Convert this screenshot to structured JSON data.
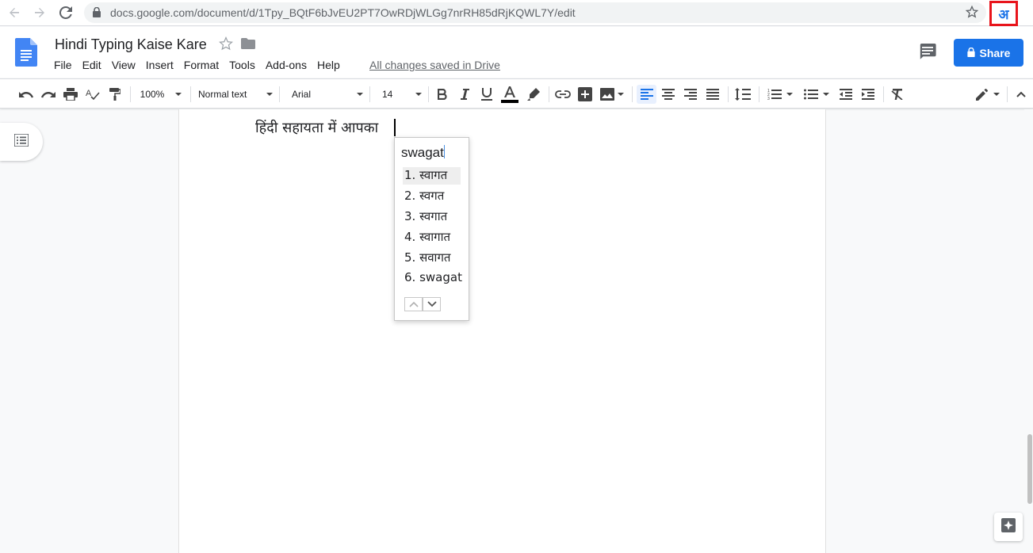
{
  "browser": {
    "url": "docs.google.com/document/d/1Tpy_BQtF6bJvEU2PT7OwRDjWLGg7nrRH85dRjKQWL7Y/edit",
    "extension_label": "अ"
  },
  "header": {
    "doc_title": "Hindi Typing Kaise Kare",
    "menu": [
      "File",
      "Edit",
      "View",
      "Insert",
      "Format",
      "Tools",
      "Add-ons",
      "Help"
    ],
    "saved_status": "All changes saved in Drive",
    "share_label": "Share"
  },
  "toolbar": {
    "zoom": "100%",
    "style": "Normal text",
    "font": "Arial",
    "font_size": "14"
  },
  "document": {
    "text": "हिंदी सहायता में आपका"
  },
  "ime": {
    "input": "swagat",
    "candidates": [
      "1. स्वागत",
      "2. स्वगत",
      "3. स्वगात",
      "4. स्वागात",
      "5. सवागत",
      "6. swagat"
    ],
    "selected_index": 0
  },
  "colors": {
    "accent": "#1a73e8",
    "highlight_border": "#e8141b"
  }
}
